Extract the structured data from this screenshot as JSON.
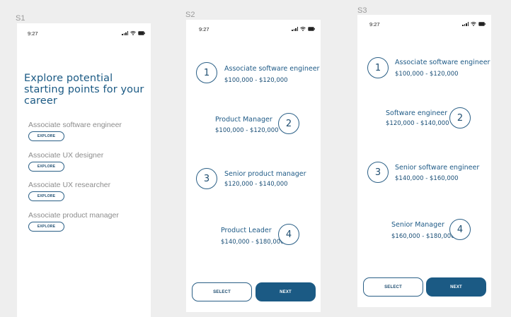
{
  "frames": {
    "s1": {
      "label": "S1"
    },
    "s2": {
      "label": "S2"
    },
    "s3": {
      "label": "S3"
    }
  },
  "status_bar": {
    "time": "9:27"
  },
  "s1": {
    "title": "Explore potential starting points for your career",
    "explore_label": "EXPLORE",
    "items": [
      {
        "label": "Associate software engineer"
      },
      {
        "label": "Associate UX designer"
      },
      {
        "label": "Associate UX researcher"
      },
      {
        "label": "Associate product manager"
      }
    ]
  },
  "s2": {
    "roles": [
      {
        "number": "1",
        "title": "Associate software engineer",
        "salary": "$100,000 - $120,000"
      },
      {
        "number": "2",
        "title": "Product Manager",
        "salary": "$100,000 - $120,000"
      },
      {
        "number": "3",
        "title": "Senior product manager",
        "salary": "$120,000 - $140,000"
      },
      {
        "number": "4",
        "title": "Product Leader",
        "salary": "$140,000 - $180,000"
      }
    ],
    "select_label": "SELECT",
    "next_label": "NEXT"
  },
  "s3": {
    "roles": [
      {
        "number": "1",
        "title": "Associate software engineer",
        "salary": "$100,000 - $120,000"
      },
      {
        "number": "2",
        "title": "Software engineer",
        "salary": "$120,000 - $140,000"
      },
      {
        "number": "3",
        "title": "Senior software engineer",
        "salary": "$140,000 - $160,000"
      },
      {
        "number": "4",
        "title": "Senior Manager",
        "salary": "$160,000 - $180,000"
      }
    ],
    "select_label": "SELECT",
    "next_label": "NEXT"
  },
  "colors": {
    "primary": "#1b5a84",
    "muted_text": "#8c8c8c",
    "canvas": "#eeeeee",
    "frame": "#ffffff"
  },
  "icons": [
    "signal-icon",
    "wifi-icon",
    "battery-icon"
  ]
}
